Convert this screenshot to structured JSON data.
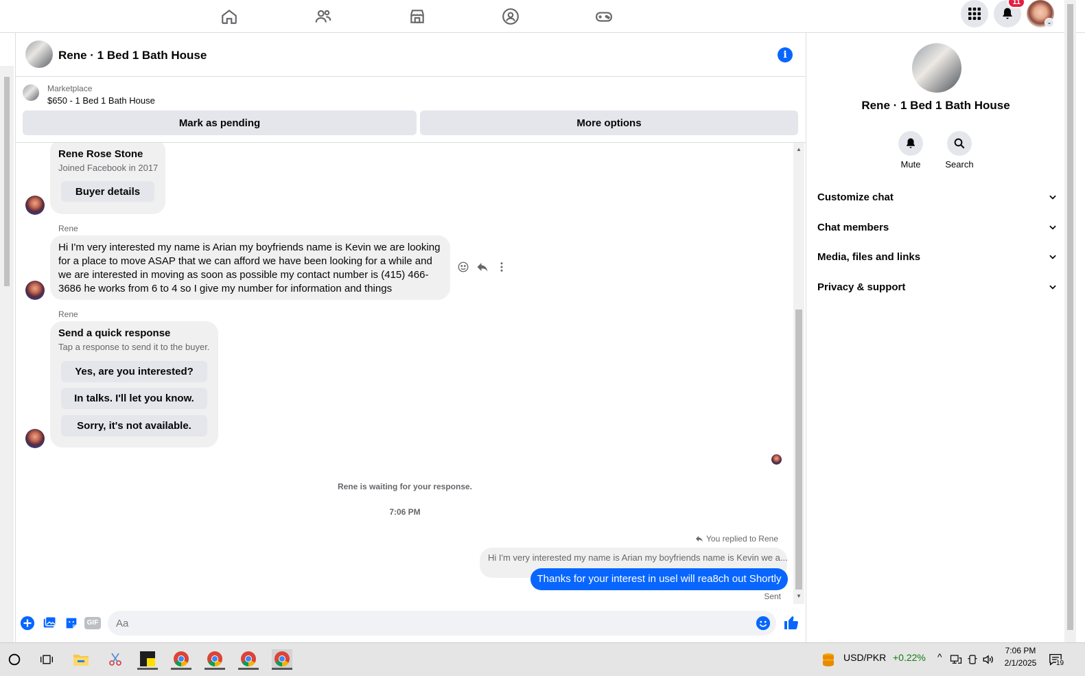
{
  "topnav": {
    "icons": [
      "home-icon",
      "friends-icon",
      "marketplace-icon",
      "groups-icon",
      "gaming-icon"
    ],
    "notification_count": "11"
  },
  "chat": {
    "title": "Rene · 1 Bed 1 Bath House",
    "marketplace_label": "Marketplace",
    "listing": "$650 - 1 Bed 1 Bath House",
    "mark_pending": "Mark as pending",
    "more_options": "More options"
  },
  "messages": {
    "profile_name": "Rene Rose Stone",
    "profile_joined": "Joined Facebook in 2017",
    "buyer_details": "Buyer details",
    "sender1": "Rene",
    "message1": "Hi I'm very interested my name is Arian my boyfriends name is Kevin we are looking for a place to move ASAP that we can afford we have been looking for a while and we are interested in moving as soon as possible my contact number is (415) 466-3686 he works from 6 to 4 so I give my number for information and things",
    "sender2": "Rene",
    "quick_title": "Send a quick response",
    "quick_sub": "Tap a response to send it to the buyer.",
    "quick_responses": [
      "Yes, are you interested?",
      "In talks. I'll let you know.",
      "Sorry, it's not available."
    ],
    "waiting": "Rene is waiting for your response.",
    "time": "7:06 PM",
    "replied_to": "You replied to Rene",
    "quoted": "Hi I'm very interested my name is Arian my boyfriends name is Kevin we a...",
    "my_reply": "Thanks for your interest in usel will rea8ch out Shortly",
    "status": "Sent"
  },
  "composer": {
    "placeholder": "Aa",
    "gif": "GIF"
  },
  "right_panel": {
    "title": "Rene · 1 Bed 1 Bath House",
    "mute": "Mute",
    "search": "Search",
    "sections": [
      "Customize chat",
      "Chat members",
      "Media, files and links",
      "Privacy & support"
    ]
  },
  "taskbar": {
    "currency": "USD/PKR",
    "change": "+0.22%",
    "time": "7:06 PM",
    "date": "2/1/2025",
    "notif": "19"
  },
  "colors": {
    "accent": "#0866ff",
    "positive": "#107c10",
    "badge": "#e41e3f"
  }
}
